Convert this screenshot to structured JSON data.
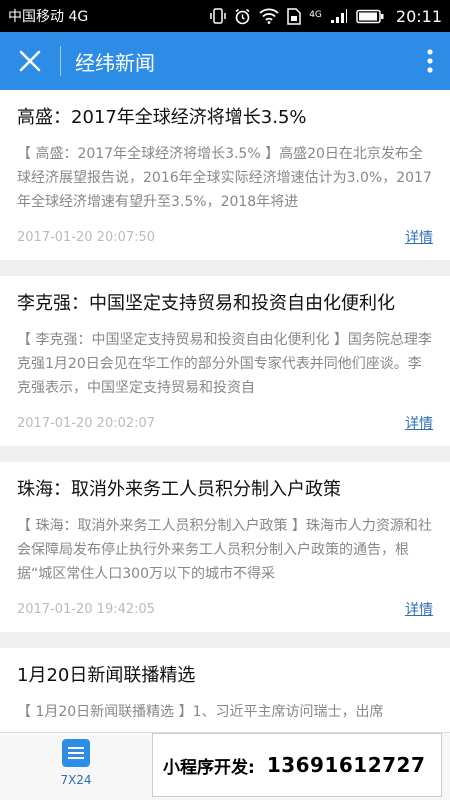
{
  "status_bar": {
    "carrier": "中国移动 4G",
    "network_badge": "4G",
    "time": "20:11"
  },
  "app_bar": {
    "title": "经纬新闻",
    "close_icon": "close-icon",
    "more_icon": "more-vertical-icon"
  },
  "articles": [
    {
      "headline": "高盛：2017年全球经济将增长3.5%",
      "summary": "【 高盛：2017年全球经济将增长3.5% 】高盛20日在北京发布全球经济展望报告说，2016年全球实际经济增速估计为3.0%，2017年全球经济增速有望升至3.5%，2018年将进",
      "time": "2017-01-20 20:07:50",
      "more_label": "详情"
    },
    {
      "headline": "李克强：中国坚定支持贸易和投资自由化便利化",
      "summary": "【 李克强：中国坚定支持贸易和投资自由化便利化 】国务院总理李克强1月20日会见在华工作的部分外国专家代表并同他们座谈。李克强表示，中国坚定支持贸易和投资自",
      "time": "2017-01-20 20:02:07",
      "more_label": "详情"
    },
    {
      "headline": "珠海：取消外来务工人员积分制入户政策",
      "summary": "【 珠海：取消外来务工人员积分制入户政策 】珠海市人力资源和社会保障局发布停止执行外来务工人员积分制入户政策的通告，根据“城区常住人口300万以下的城市不得采",
      "time": "2017-01-20 19:42:05",
      "more_label": "详情"
    },
    {
      "headline": "1月20日新闻联播精选",
      "summary": "【 1月20日新闻联播精选 】1、习近平主席访问瑞士，出席",
      "time": "",
      "more_label": ""
    }
  ],
  "bottom_bar": {
    "tab_label": "7X24",
    "tab_icon": "list-icon"
  },
  "promo": {
    "label": "小程序开发:",
    "phone": "13691612727"
  }
}
